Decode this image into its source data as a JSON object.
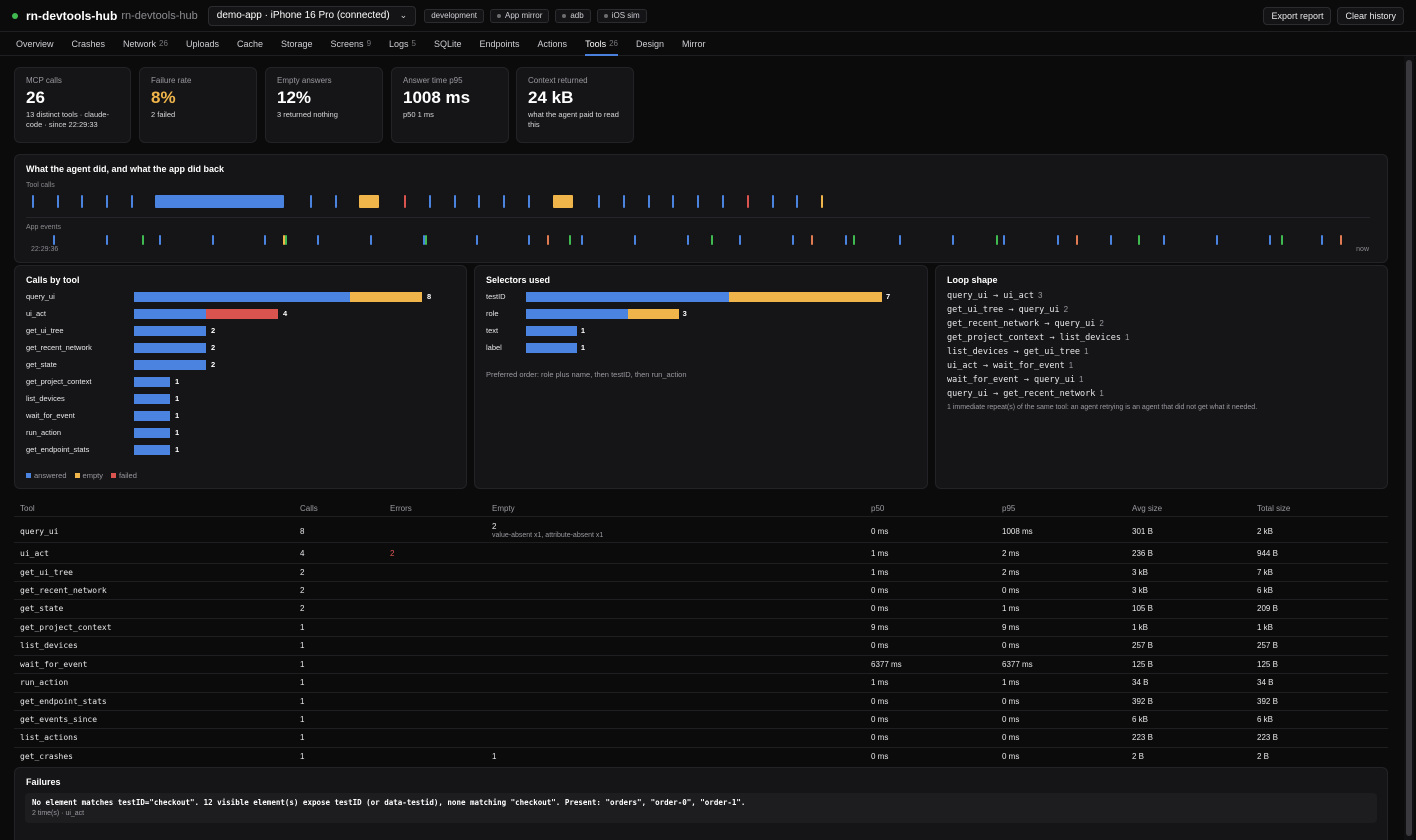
{
  "app": {
    "name": "rn-devtools-hub",
    "sub": "rn-devtools-hub"
  },
  "device": {
    "label": "demo-app · iPhone 16 Pro (connected)"
  },
  "env_pills": [
    "development",
    "App mirror",
    "adb",
    "iOS sim"
  ],
  "actions": {
    "export": "Export report",
    "clear": "Clear history"
  },
  "tabs": [
    {
      "label": "Overview",
      "count": ""
    },
    {
      "label": "Crashes",
      "count": ""
    },
    {
      "label": "Network",
      "count": "26"
    },
    {
      "label": "Uploads",
      "count": ""
    },
    {
      "label": "Cache",
      "count": ""
    },
    {
      "label": "Storage",
      "count": ""
    },
    {
      "label": "Screens",
      "count": "9"
    },
    {
      "label": "Logs",
      "count": "5"
    },
    {
      "label": "SQLite",
      "count": ""
    },
    {
      "label": "Endpoints",
      "count": ""
    },
    {
      "label": "Actions",
      "count": ""
    },
    {
      "label": "Tools",
      "count": "26"
    },
    {
      "label": "Design",
      "count": ""
    },
    {
      "label": "Mirror",
      "count": ""
    }
  ],
  "active_tab": "Tools",
  "stats": [
    {
      "label": "MCP calls",
      "value": "26",
      "sub": "13 distinct tools · claude-code · since 22:29:33"
    },
    {
      "label": "Failure rate",
      "value": "8%",
      "sub": "2 failed"
    },
    {
      "label": "Empty answers",
      "value": "12%",
      "sub": "3 returned nothing"
    },
    {
      "label": "Answer time p95",
      "value": "1008 ms",
      "sub": "p50 1 ms"
    },
    {
      "label": "Context returned",
      "value": "24 kB",
      "sub": "what the agent paid to read this"
    }
  ],
  "timeline": {
    "title": "What the agent did, and what the app did back",
    "lane_tool": "Tool calls",
    "lane_app": "App events",
    "start": "22:29:36",
    "end": "now",
    "colors": {
      "answered": "#4a84e0",
      "empty": "#f0b54a",
      "failed": "#d9534f",
      "green": "#3fb950",
      "orange": "#e07a52"
    }
  },
  "calls_by_tool": {
    "title": "Calls by tool",
    "max": 8,
    "rows": [
      {
        "tool": "query_ui",
        "answered": 6,
        "empty": 2,
        "failed": 0,
        "total": "8"
      },
      {
        "tool": "ui_act",
        "answered": 2,
        "empty": 0,
        "failed": 2,
        "total": "4"
      },
      {
        "tool": "get_ui_tree",
        "answered": 2,
        "empty": 0,
        "failed": 0,
        "total": "2"
      },
      {
        "tool": "get_recent_network",
        "answered": 2,
        "empty": 0,
        "failed": 0,
        "total": "2"
      },
      {
        "tool": "get_state",
        "answered": 2,
        "empty": 0,
        "failed": 0,
        "total": "2"
      },
      {
        "tool": "get_project_context",
        "answered": 1,
        "empty": 0,
        "failed": 0,
        "total": "1"
      },
      {
        "tool": "list_devices",
        "answered": 1,
        "empty": 0,
        "failed": 0,
        "total": "1"
      },
      {
        "tool": "wait_for_event",
        "answered": 1,
        "empty": 0,
        "failed": 0,
        "total": "1"
      },
      {
        "tool": "run_action",
        "answered": 1,
        "empty": 0,
        "failed": 0,
        "total": "1"
      },
      {
        "tool": "get_endpoint_stats",
        "answered": 1,
        "empty": 0,
        "failed": 0,
        "total": "1"
      }
    ],
    "legend": [
      "answered",
      "empty",
      "failed"
    ]
  },
  "selectors": {
    "title": "Selectors used",
    "max": 7,
    "rows": [
      {
        "name": "testID",
        "answered": 4,
        "empty": 3,
        "total": "7"
      },
      {
        "name": "role",
        "answered": 2,
        "empty": 1,
        "total": "3"
      },
      {
        "name": "text",
        "answered": 1,
        "empty": 0,
        "total": "1"
      },
      {
        "name": "label",
        "answered": 1,
        "empty": 0,
        "total": "1"
      }
    ],
    "note": "Preferred order: role plus name, then testID, then run_action"
  },
  "loop_shape": {
    "title": "Loop shape",
    "items": [
      {
        "seq": "query_ui → ui_act",
        "n": "3"
      },
      {
        "seq": "get_ui_tree → query_ui",
        "n": "2"
      },
      {
        "seq": "get_recent_network → query_ui",
        "n": "2"
      },
      {
        "seq": "get_project_context → list_devices",
        "n": "1"
      },
      {
        "seq": "list_devices → get_ui_tree",
        "n": "1"
      },
      {
        "seq": "ui_act → wait_for_event",
        "n": "1"
      },
      {
        "seq": "wait_for_event → query_ui",
        "n": "1"
      },
      {
        "seq": "query_ui → get_recent_network",
        "n": "1"
      }
    ],
    "note": "1 immediate repeat(s) of the same tool: an agent retrying is an agent that did not get what it needed."
  },
  "table": {
    "headers": [
      "Tool",
      "Calls",
      "Errors",
      "Empty",
      "p50",
      "p95",
      "Avg size",
      "Total size"
    ],
    "rows": [
      {
        "tool": "query_ui",
        "calls": "8",
        "errors": "",
        "empty": "2",
        "empty_detail": "value-absent x1, attribute-absent x1",
        "p50": "0 ms",
        "p95": "1008 ms",
        "avg": "301 B",
        "total": "2 kB"
      },
      {
        "tool": "ui_act",
        "calls": "4",
        "errors": "2",
        "empty": "",
        "empty_detail": "",
        "p50": "1 ms",
        "p95": "2 ms",
        "avg": "236 B",
        "total": "944 B"
      },
      {
        "tool": "get_ui_tree",
        "calls": "2",
        "errors": "",
        "empty": "",
        "empty_detail": "",
        "p50": "1 ms",
        "p95": "2 ms",
        "avg": "3 kB",
        "total": "7 kB"
      },
      {
        "tool": "get_recent_network",
        "calls": "2",
        "errors": "",
        "empty": "",
        "empty_detail": "",
        "p50": "0 ms",
        "p95": "0 ms",
        "avg": "3 kB",
        "total": "6 kB"
      },
      {
        "tool": "get_state",
        "calls": "2",
        "errors": "",
        "empty": "",
        "empty_detail": "",
        "p50": "0 ms",
        "p95": "1 ms",
        "avg": "105 B",
        "total": "209 B"
      },
      {
        "tool": "get_project_context",
        "calls": "1",
        "errors": "",
        "empty": "",
        "empty_detail": "",
        "p50": "9 ms",
        "p95": "9 ms",
        "avg": "1 kB",
        "total": "1 kB"
      },
      {
        "tool": "list_devices",
        "calls": "1",
        "errors": "",
        "empty": "",
        "empty_detail": "",
        "p50": "0 ms",
        "p95": "0 ms",
        "avg": "257 B",
        "total": "257 B"
      },
      {
        "tool": "wait_for_event",
        "calls": "1",
        "errors": "",
        "empty": "",
        "empty_detail": "",
        "p50": "6377 ms",
        "p95": "6377 ms",
        "avg": "125 B",
        "total": "125 B"
      },
      {
        "tool": "run_action",
        "calls": "1",
        "errors": "",
        "empty": "",
        "empty_detail": "",
        "p50": "1 ms",
        "p95": "1 ms",
        "avg": "34 B",
        "total": "34 B"
      },
      {
        "tool": "get_endpoint_stats",
        "calls": "1",
        "errors": "",
        "empty": "",
        "empty_detail": "",
        "p50": "0 ms",
        "p95": "0 ms",
        "avg": "392 B",
        "total": "392 B"
      },
      {
        "tool": "get_events_since",
        "calls": "1",
        "errors": "",
        "empty": "",
        "empty_detail": "",
        "p50": "0 ms",
        "p95": "0 ms",
        "avg": "6 kB",
        "total": "6 kB"
      },
      {
        "tool": "list_actions",
        "calls": "1",
        "errors": "",
        "empty": "",
        "empty_detail": "",
        "p50": "0 ms",
        "p95": "0 ms",
        "avg": "223 B",
        "total": "223 B"
      },
      {
        "tool": "get_crashes",
        "calls": "1",
        "errors": "",
        "empty": "1",
        "empty_detail": "",
        "p50": "0 ms",
        "p95": "0 ms",
        "avg": "2 B",
        "total": "2 B"
      }
    ]
  },
  "failures": {
    "title": "Failures",
    "message": "No element matches testID=\"checkout\". 12 visible element(s) expose testID (or data-testid), none matching \"checkout\". Present: \"orders\", \"order-0\", \"order-1\".",
    "meta": "2 time(s) · ui_act"
  }
}
